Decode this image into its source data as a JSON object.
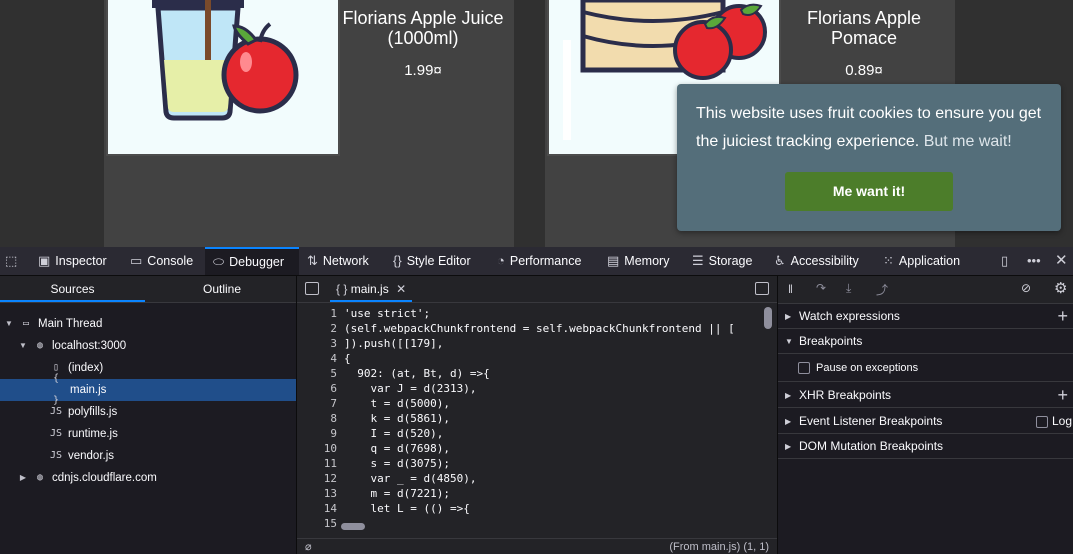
{
  "products": [
    {
      "name": "Florians Apple Juice (1000ml)",
      "price": "1.99¤"
    },
    {
      "name": "Florians Apple Pomace",
      "price": "0.89¤"
    }
  ],
  "cookie_banner": {
    "message": "This website uses fruit cookies to ensure you get the juiciest tracking experience.",
    "more": "But me wait!",
    "button": "Me want it!"
  },
  "devtools": {
    "tabs": [
      {
        "label": "Inspector",
        "icon": "inspector-icon"
      },
      {
        "label": "Console",
        "icon": "console-icon"
      },
      {
        "label": "Debugger",
        "icon": "debugger-icon",
        "active": true
      },
      {
        "label": "Network",
        "icon": "network-icon"
      },
      {
        "label": "Style Editor",
        "icon": "style-editor-icon"
      },
      {
        "label": "Performance",
        "icon": "performance-icon"
      },
      {
        "label": "Memory",
        "icon": "memory-icon"
      },
      {
        "label": "Storage",
        "icon": "storage-icon"
      },
      {
        "label": "Accessibility",
        "icon": "accessibility-icon"
      },
      {
        "label": "Application",
        "icon": "application-icon"
      }
    ],
    "sources": {
      "tabs": [
        "Sources",
        "Outline"
      ],
      "tree": [
        {
          "label": "Main Thread"
        },
        {
          "label": "localhost:3000"
        },
        {
          "label": "(index)"
        },
        {
          "label": "main.js"
        },
        {
          "label": "polyfills.js"
        },
        {
          "label": "runtime.js"
        },
        {
          "label": "vendor.js"
        },
        {
          "label": "cdnjs.cloudflare.com"
        }
      ],
      "file_icon_text": "JS",
      "braces_icon_text": "{ }"
    },
    "editor": {
      "tab_label": "main.js",
      "line_numbers": [
        "1",
        "2",
        "3",
        "4",
        "5",
        "6",
        "7",
        "8",
        "9",
        "10",
        "11",
        "12",
        "13",
        "14",
        "15"
      ],
      "lines": [
        "'use strict';",
        "(self.webpackChunkfrontend = self.webpackChunkfrontend || [",
        "]).push([[179],",
        "{",
        "  902: (at, Bt, d) =>{",
        "    var J = d(2313),",
        "    t = d(5000),",
        "    k = d(5861),",
        "    I = d(520),",
        "    q = d(7698),",
        "    s = d(3075);",
        "    var _ = d(4850),",
        "    m = d(7221);",
        "    let L = (() =>{",
        ""
      ],
      "status": "(From main.js)  (1, 1)"
    },
    "right_panel": {
      "sections": [
        "Watch expressions",
        "Breakpoints",
        "Pause on exceptions",
        "XHR Breakpoints",
        "Event Listener Breakpoints",
        "DOM Mutation Breakpoints"
      ],
      "log_label": "Log"
    }
  }
}
